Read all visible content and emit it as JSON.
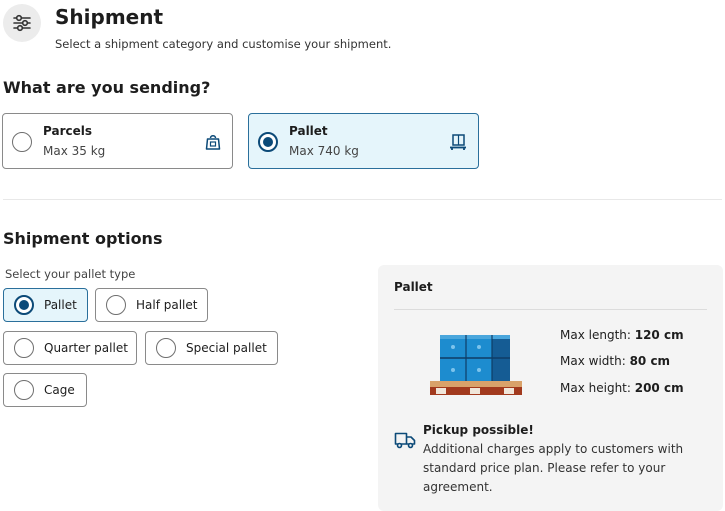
{
  "header": {
    "icon": "sliders-icon",
    "title": "Shipment",
    "subtitle": "Select a shipment category and customise your shipment."
  },
  "sending": {
    "heading": "What are you sending?",
    "options": [
      {
        "name": "Parcels",
        "limit": "Max 35 kg",
        "icon": "parcel-bag-icon",
        "selected": false
      },
      {
        "name": "Pallet",
        "limit": "Max 740 kg",
        "icon": "pallet-icon",
        "selected": true
      }
    ]
  },
  "options": {
    "heading": "Shipment options",
    "pallet_type_label": "Select your pallet type",
    "pallet_types": [
      {
        "label": "Pallet",
        "selected": true
      },
      {
        "label": "Half pallet",
        "selected": false
      },
      {
        "label": "Quarter pallet",
        "selected": false
      },
      {
        "label": "Special pallet",
        "selected": false
      },
      {
        "label": "Cage",
        "selected": false
      }
    ]
  },
  "summary": {
    "title": "Pallet",
    "specs": [
      {
        "label": "Max length: ",
        "value": "120 cm"
      },
      {
        "label": "Max width: ",
        "value": "80 cm"
      },
      {
        "label": "Max height: ",
        "value": "200 cm"
      }
    ],
    "pickup_icon": "truck-icon",
    "pickup_title": "Pickup possible!",
    "pickup_text": "Additional charges apply to customers with standard price plan. Please refer to your agreement."
  },
  "colors": {
    "accent": "#0c4a78",
    "selected_bg": "#e5f5fb",
    "selected_border": "#2a6f9b",
    "panel_bg": "#f4f4f4"
  }
}
